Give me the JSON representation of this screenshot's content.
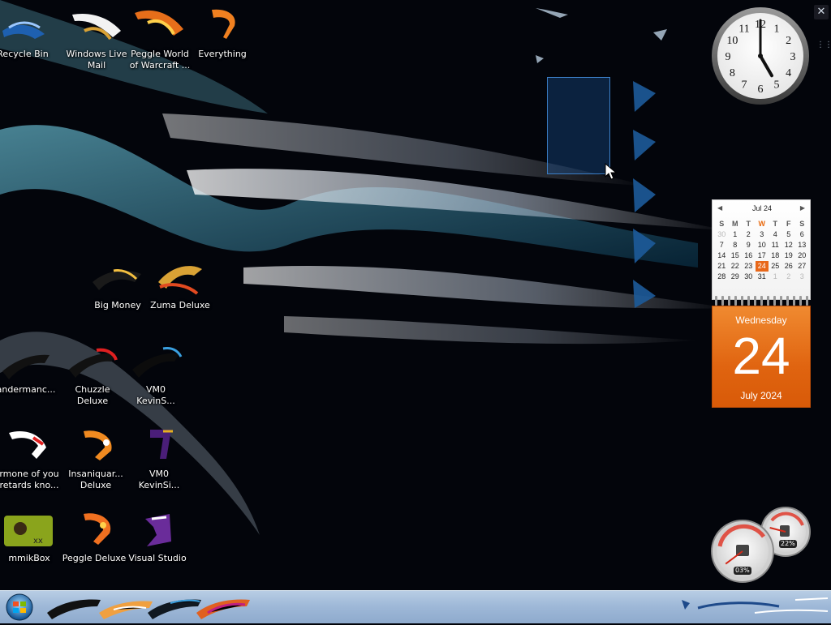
{
  "desktop": {
    "icons": [
      {
        "label": "Recycle Bin",
        "name": "recycle-bin-icon"
      },
      {
        "label": "Windows Live\nMail",
        "name": "windows-live-mail-icon"
      },
      {
        "label": "Peggle World\nof Warcraft ...",
        "name": "peggle-wow-icon"
      },
      {
        "label": "Everything",
        "name": "everything-icon"
      },
      {
        "label": "Zuma Deluxe",
        "name": "zuma-deluxe-icon"
      },
      {
        "label": "Big Money",
        "name": "big-money-icon"
      },
      {
        "label": "Chuzzle\nDeluxe",
        "name": "chuzzle-deluxe-icon"
      },
      {
        "label": "VM0\nKevinS...",
        "name": "vm-kevins-icon"
      },
      {
        "label": "Insaniquar...\nDeluxe",
        "name": "insaniquarium-icon"
      },
      {
        "label": "VM0\nKevinSi...",
        "name": "vm-kevinsi-icon"
      },
      {
        "label": "Peggle Deluxe",
        "name": "peggle-deluxe-icon"
      },
      {
        "label": "Visual Studio",
        "name": "visual-studio-icon"
      },
      {
        "label": "andermanc...",
        "name": "andermanc-icon"
      },
      {
        "label": "rmone of you\nretards kno...",
        "name": "folder-note-icon"
      },
      {
        "label": "mmikBox",
        "name": "mmikbox-icon"
      }
    ]
  },
  "gadgets": {
    "close_glyph": "✕",
    "grip_glyph": "⋮⋮",
    "calendar": {
      "month_label": "Jul 24",
      "prev_glyph": "◀",
      "next_glyph": "▶",
      "headers": [
        "S",
        "M",
        "T",
        "W",
        "T",
        "F",
        "S"
      ],
      "rows": [
        [
          "30",
          "1",
          "2",
          "3",
          "4",
          "5",
          "6"
        ],
        [
          "7",
          "8",
          "9",
          "10",
          "11",
          "12",
          "13"
        ],
        [
          "14",
          "15",
          "16",
          "17",
          "18",
          "19",
          "20"
        ],
        [
          "21",
          "22",
          "23",
          "24",
          "25",
          "26",
          "27"
        ],
        [
          "28",
          "29",
          "30",
          "31",
          "1",
          "2",
          "3"
        ]
      ],
      "today": "24",
      "weekday": "Wednesday",
      "day": "24",
      "month_year": "July 2024"
    },
    "clock": {
      "hour": 5,
      "minute": 0,
      "numerals": [
        "12",
        "1",
        "2",
        "3",
        "4",
        "5",
        "6",
        "7",
        "8",
        "9",
        "10",
        "11"
      ]
    },
    "cpu_meter": {
      "cpu_percent": "03%",
      "memory_percent": "22%",
      "cpu_value": 3,
      "memory_value": 22
    }
  },
  "colors": {
    "selection": "#3c7fc7",
    "calendar_accent": "#e8681a",
    "taskbar": "#9fb9d8"
  }
}
